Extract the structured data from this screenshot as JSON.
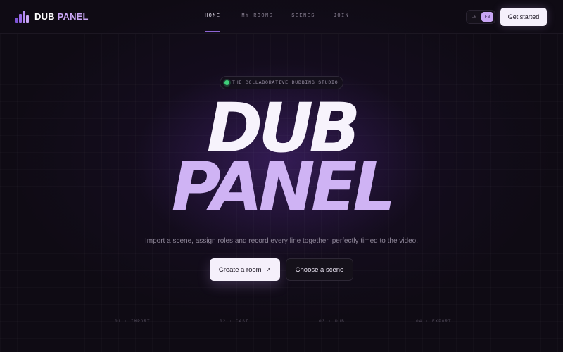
{
  "app": {
    "logo": {
      "word1": "DUB",
      "word2": "PANEL",
      "icon": "equalizer-bars-icon",
      "accent": "#9b6ce8"
    }
  },
  "nav": {
    "links": [
      {
        "label": "HOME",
        "active": true
      },
      {
        "label": "MY ROOMS",
        "active": false
      },
      {
        "label": "SCENES",
        "active": false
      },
      {
        "label": "JOIN",
        "active": false
      }
    ],
    "language": {
      "options": [
        "FR",
        "EN"
      ],
      "selected": "EN"
    },
    "cta_label": "Get started"
  },
  "hero": {
    "badge": "THE COLLABORATIVE DUBBING STUDIO",
    "title_line1": "DUB",
    "title_line2": "PANEL",
    "subtitle": "Import a scene, assign roles and record every line together, perfectly timed to the video.",
    "primary_cta": "Create a room",
    "primary_cta_icon": "arrow-up-right-icon",
    "secondary_cta": "Choose a scene"
  },
  "steps": [
    {
      "label": "01 · IMPORT"
    },
    {
      "label": "02 · CAST"
    },
    {
      "label": "03 · DUB"
    },
    {
      "label": "04 · EXPORT"
    }
  ],
  "colors": {
    "background": "#0f0b14",
    "title_primary": "#f7f3fc",
    "title_accent": "#cfb3f4",
    "status_online": "#3fd07a"
  }
}
